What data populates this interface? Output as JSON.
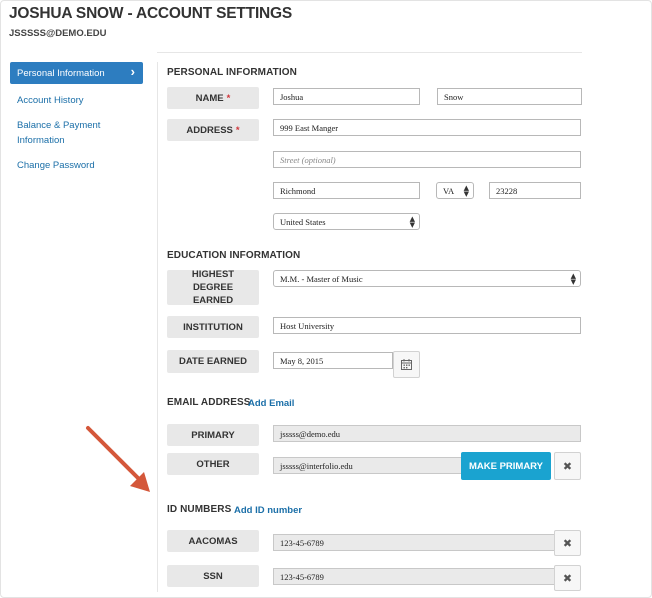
{
  "header": {
    "title": "JOSHUA SNOW - ACCOUNT SETTINGS",
    "email": "JSSSSS@DEMO.EDU"
  },
  "sidebar": {
    "items": [
      {
        "label": "Personal Information",
        "active": true
      },
      {
        "label": "Account History"
      },
      {
        "label": "Balance & Payment Information"
      },
      {
        "label": "Change Password"
      }
    ]
  },
  "personal": {
    "section_title": "PERSONAL INFORMATION",
    "name_label": "NAME",
    "required_mark": "*",
    "first_name": "Joshua",
    "last_name": "Snow",
    "address_label": "ADDRESS",
    "street1": "999 East Manger",
    "street2_placeholder": "Street (optional)",
    "city": "Richmond",
    "state": "VA",
    "zip": "23228",
    "country": "United States"
  },
  "education": {
    "section_title": "EDUCATION INFORMATION",
    "degree_label": "HIGHEST DEGREE EARNED",
    "degree_value": "M.M. - Master of Music",
    "institution_label": "INSTITUTION",
    "institution_value": "Host University",
    "date_label": "DATE EARNED",
    "date_value": "May 8, 2015"
  },
  "email": {
    "section_title": "EMAIL ADDRESS",
    "add_link": "Add Email",
    "primary_label": "PRIMARY",
    "primary_value": "jsssss@demo.edu",
    "other_label": "OTHER",
    "other_value": "jsssss@interfolio.edu",
    "make_primary": "MAKE PRIMARY"
  },
  "ids": {
    "section_title": "ID NUMBERS",
    "add_link": "Add ID number",
    "rows": [
      {
        "label": "AACOMAS",
        "value": "123-45-6789"
      },
      {
        "label": "SSN",
        "value": "123-45-6789"
      }
    ]
  },
  "colors": {
    "accent": "#2d7dc0",
    "button": "#1aa3d0",
    "required": "#d0363b",
    "annotation_arrow": "#d4573a"
  }
}
